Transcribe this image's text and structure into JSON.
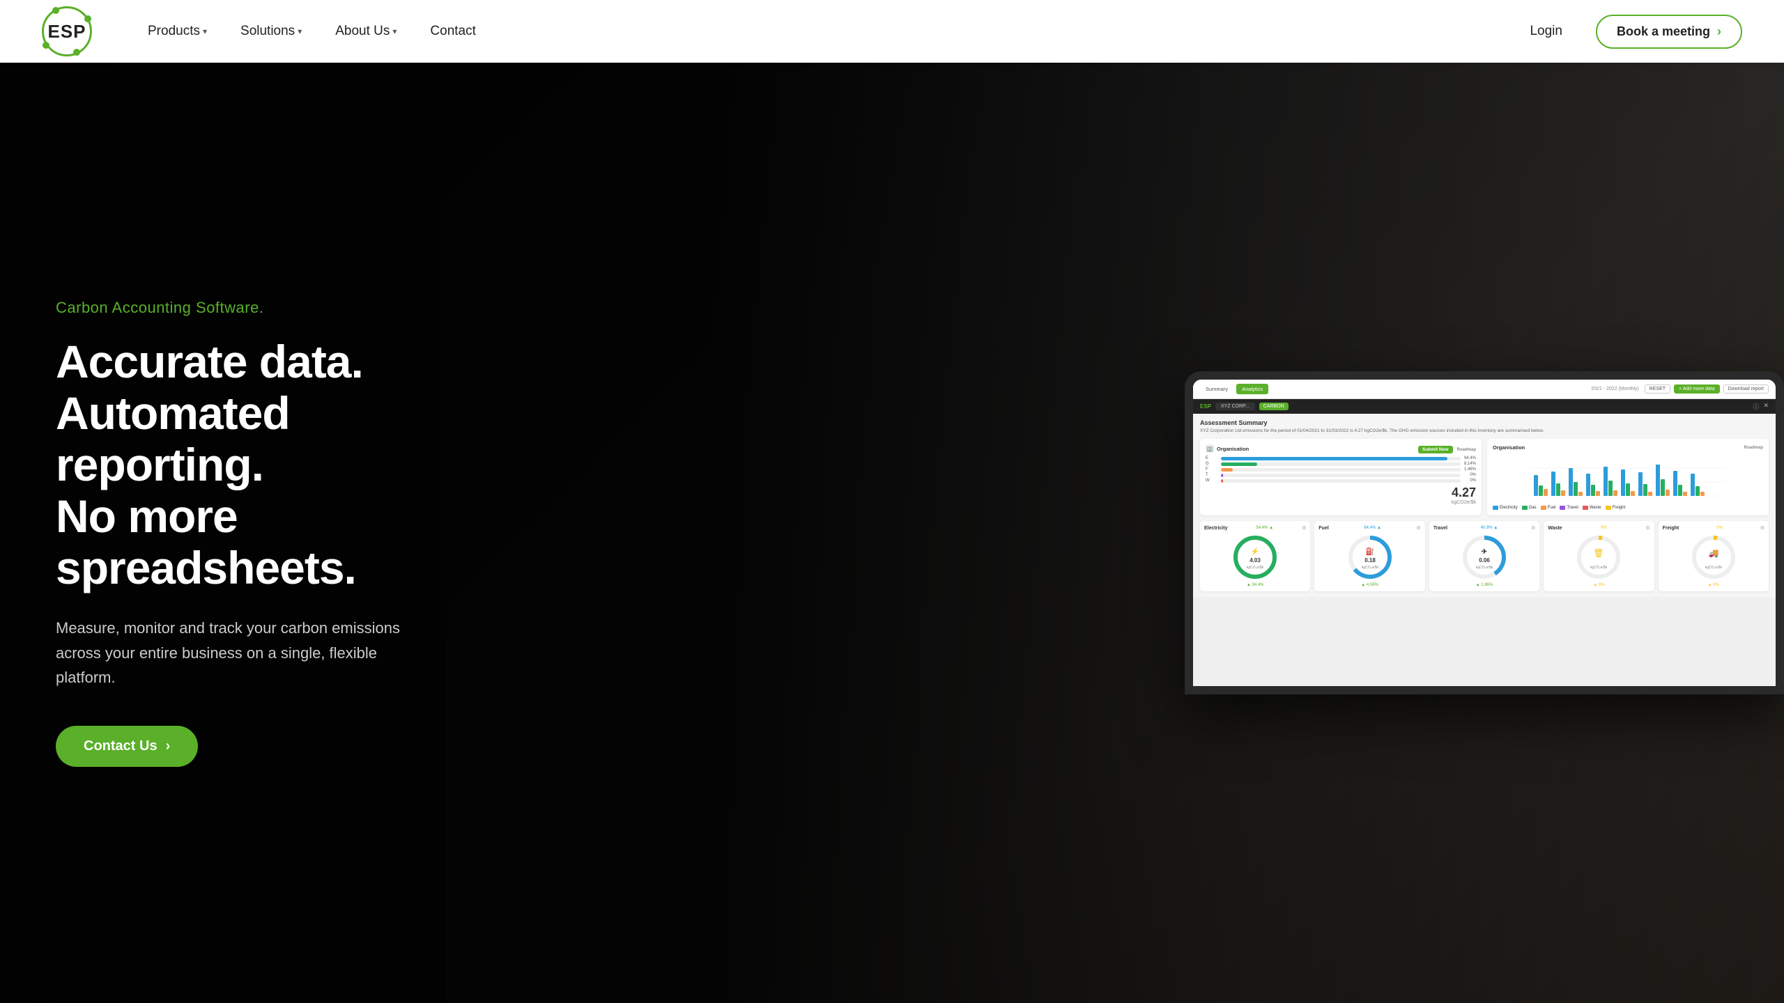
{
  "navbar": {
    "logo_text": "ESP",
    "nav_items": [
      {
        "label": "Products",
        "has_dropdown": true
      },
      {
        "label": "Solutions",
        "has_dropdown": true
      },
      {
        "label": "About Us",
        "has_dropdown": true
      },
      {
        "label": "Contact",
        "has_dropdown": false
      }
    ],
    "login_label": "Login",
    "book_btn_label": "Book a meeting"
  },
  "hero": {
    "subtitle": "Carbon Accounting Software.",
    "title_line1": "Accurate data.",
    "title_line2": "Automated reporting.",
    "title_line3": "No more spreadsheets.",
    "description": "Measure, monitor and track your carbon emissions across your entire business on a single, flexible platform.",
    "cta_label": "Contact Us"
  },
  "dashboard": {
    "tab1": "Summary",
    "tab2": "Analytics",
    "period": "2021 - 2022 (Monthly)",
    "btn_reset": "RESET",
    "btn_add": "+ Add more data",
    "btn_download": "Download report",
    "brand": "ESP",
    "org_dropdown": "XYZ CORP...",
    "carbon_badge": "CARBON",
    "assessment_title": "Assessment Summary",
    "assessment_desc": "XYZ Corporation Ltd emissions for the period of 01/04/2021 to 31/03/2022 is 4.27 kgCO2e/$k. The GHG emission sources included in this inventory are summarised below.",
    "org_label": "Organisation",
    "submit_now": "Submit Now",
    "roadmap": "Roadmap",
    "big_value": "4.27",
    "big_unit": "kgCO2e/$k",
    "bar_rows": [
      {
        "label": "E",
        "pct": 94.4,
        "color": "#2d9cdb",
        "val": "94.4%"
      },
      {
        "label": "G",
        "pct": 8.14,
        "color": "#27ae60",
        "val": "8.14%"
      },
      {
        "label": "F",
        "pct": 1.46,
        "color": "#f2994a",
        "val": "1.46%"
      },
      {
        "label": "T",
        "pct": 0,
        "color": "#9b51e0",
        "val": "0%"
      },
      {
        "label": "W",
        "pct": 0,
        "color": "#eb5757",
        "val": "0%"
      }
    ],
    "chart_legend": [
      "Electricity",
      "Gas",
      "Fuel",
      "Travel",
      "Waste",
      "Freight"
    ],
    "chart_colors": [
      "#2d9cdb",
      "#27ae60",
      "#f2994a",
      "#9b51e0",
      "#eb5757",
      "#f5c518"
    ],
    "gauges": [
      {
        "title": "Electricity",
        "pct": "54.4%",
        "value": "4.03",
        "unit": "kgCO2e/$k",
        "color": "#27ae60",
        "icon": "⚡",
        "bottom": "▲ 34.4%"
      },
      {
        "title": "Fuel",
        "pct": "64.4%",
        "value": "0.18",
        "unit": "kgCO2e/$k",
        "color": "#2d9cdb",
        "icon": "⛽",
        "bottom": "▲ 4.59%"
      },
      {
        "title": "Travel",
        "pct": "40.9%",
        "value": "0.06",
        "unit": "kgCO2e/$k",
        "color": "#2d9cdb",
        "icon": "✈",
        "bottom": "▲ 1.86%"
      },
      {
        "title": "Waste",
        "pct": "0%",
        "value": "",
        "unit": "kgCO2e/$k",
        "color": "#f5c518",
        "icon": "🗑",
        "bottom": "▲ 0%"
      },
      {
        "title": "Freight",
        "pct": "0%",
        "value": "",
        "unit": "kgCO2e/$k",
        "color": "#f5c518",
        "icon": "🚚",
        "bottom": "▲ 0%"
      }
    ]
  }
}
